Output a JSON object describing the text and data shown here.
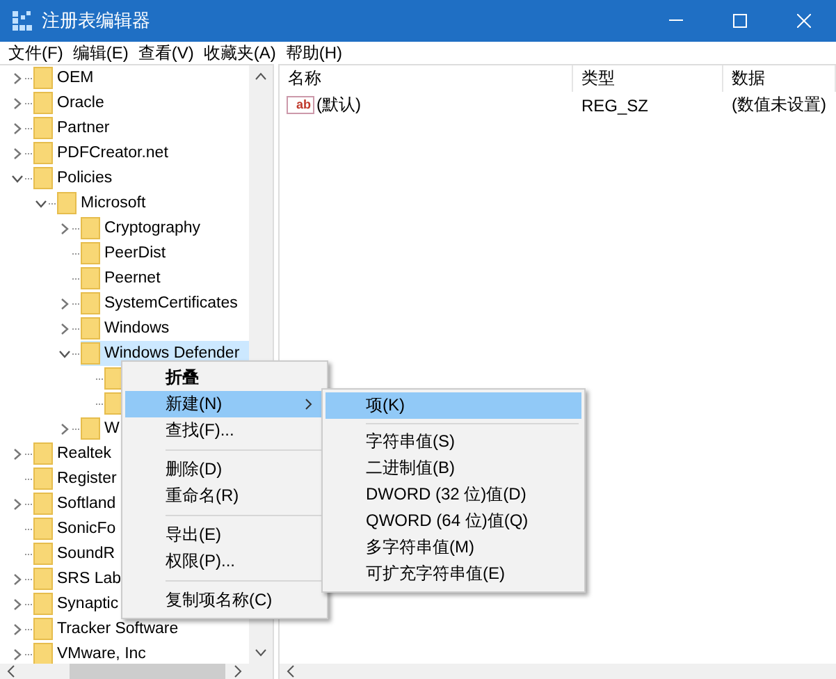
{
  "window": {
    "title": "注册表编辑器"
  },
  "menu_bar": [
    "文件(F)",
    "编辑(E)",
    "查看(V)",
    "收藏夹(A)",
    "帮助(H)"
  ],
  "tree": [
    {
      "label": "OEM",
      "has_children": true,
      "expanded": false,
      "selected": false
    },
    {
      "label": "Oracle",
      "has_children": true,
      "expanded": false,
      "selected": false
    },
    {
      "label": "Partner",
      "has_children": true,
      "expanded": false,
      "selected": false
    },
    {
      "label": "PDFCreator.net",
      "has_children": true,
      "expanded": false,
      "selected": false
    },
    {
      "label": "Policies",
      "has_children": true,
      "expanded": true,
      "selected": false,
      "children": [
        {
          "label": "Microsoft",
          "has_children": true,
          "expanded": true,
          "selected": false,
          "children": [
            {
              "label": "Cryptography",
              "has_children": true,
              "expanded": false,
              "selected": false
            },
            {
              "label": "PeerDist",
              "has_children": false,
              "selected": false
            },
            {
              "label": "Peernet",
              "has_children": false,
              "selected": false
            },
            {
              "label": "SystemCertificates",
              "has_children": true,
              "expanded": false,
              "selected": false
            },
            {
              "label": "Windows",
              "has_children": true,
              "expanded": false,
              "selected": false
            },
            {
              "label": "Windows Defender",
              "has_children": true,
              "expanded": true,
              "selected": true,
              "children": [
                {
                  "has_children": false,
                  "selected": false
                },
                {
                  "has_children": false,
                  "selected": false
                }
              ]
            },
            {
              "label": "W",
              "has_children": true,
              "expanded": false,
              "selected": false
            }
          ]
        }
      ]
    },
    {
      "label": "Realtek",
      "has_children": true,
      "expanded": false,
      "selected": false
    },
    {
      "label": "Register",
      "has_children": false,
      "selected": false
    },
    {
      "label": "Softland",
      "has_children": true,
      "expanded": false,
      "selected": false
    },
    {
      "label": "SonicFo",
      "has_children": false,
      "selected": false
    },
    {
      "label": "SoundR",
      "has_children": false,
      "selected": false
    },
    {
      "label": "SRS Lab",
      "has_children": true,
      "expanded": false,
      "selected": false
    },
    {
      "label": "Synaptic",
      "has_children": true,
      "expanded": false,
      "selected": false
    },
    {
      "label": "Tracker Software",
      "has_children": true,
      "expanded": false,
      "selected": false
    },
    {
      "label": "VMware, Inc",
      "has_children": true,
      "expanded": false,
      "selected": false
    }
  ],
  "list": {
    "columns": [
      "名称",
      "类型",
      "数据"
    ],
    "rows": [
      {
        "icon": "ab",
        "name": "(默认)",
        "type": "REG_SZ",
        "data": "(数值未设置)"
      }
    ]
  },
  "context_menu": [
    {
      "kind": "item",
      "label": "折叠",
      "default": true,
      "selected": false,
      "submenu": false
    },
    {
      "kind": "item",
      "label": "新建(N)",
      "default": false,
      "selected": true,
      "submenu": true
    },
    {
      "kind": "item",
      "label": "查找(F)...",
      "default": false,
      "selected": false,
      "submenu": false
    },
    {
      "kind": "separator"
    },
    {
      "kind": "item",
      "label": "删除(D)",
      "default": false,
      "selected": false,
      "submenu": false
    },
    {
      "kind": "item",
      "label": "重命名(R)",
      "default": false,
      "selected": false,
      "submenu": false
    },
    {
      "kind": "separator"
    },
    {
      "kind": "item",
      "label": "导出(E)",
      "default": false,
      "selected": false,
      "submenu": false
    },
    {
      "kind": "item",
      "label": "权限(P)...",
      "default": false,
      "selected": false,
      "submenu": false
    },
    {
      "kind": "separator"
    },
    {
      "kind": "item",
      "label": "复制项名称(C)",
      "default": false,
      "selected": false,
      "submenu": false
    }
  ],
  "submenu": [
    {
      "kind": "item",
      "label": "项(K)",
      "default": false,
      "selected": true,
      "submenu": false
    },
    {
      "kind": "separator"
    },
    {
      "kind": "item",
      "label": "字符串值(S)",
      "default": false,
      "selected": false,
      "submenu": false
    },
    {
      "kind": "item",
      "label": "二进制值(B)",
      "default": false,
      "selected": false,
      "submenu": false
    },
    {
      "kind": "item",
      "label": "DWORD (32 位)值(D)",
      "default": false,
      "selected": false,
      "submenu": false
    },
    {
      "kind": "item",
      "label": "QWORD (64 位)值(Q)",
      "default": false,
      "selected": false,
      "submenu": false
    },
    {
      "kind": "item",
      "label": "多字符串值(M)",
      "default": false,
      "selected": false,
      "submenu": false
    },
    {
      "kind": "item",
      "label": "可扩充字符串值(E)",
      "default": false,
      "selected": false,
      "submenu": false
    }
  ]
}
